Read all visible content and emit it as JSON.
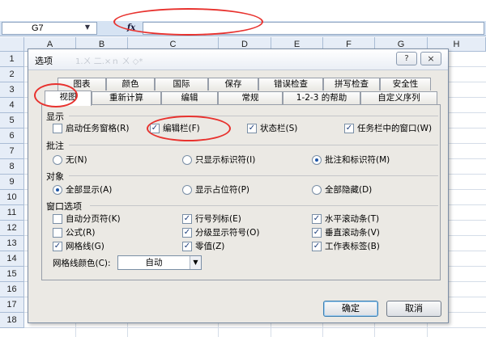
{
  "spreadsheet": {
    "name_box": "G7",
    "fx_symbol": "fx",
    "columns": [
      "A",
      "B",
      "C",
      "D",
      "E",
      "F",
      "G",
      "H"
    ],
    "rows": [
      "1",
      "2",
      "3",
      "4",
      "5",
      "6",
      "7",
      "8",
      "9",
      "10",
      "11",
      "12",
      "13",
      "14",
      "15",
      "16",
      "17",
      "18"
    ]
  },
  "dialog": {
    "title": "选项",
    "title_ghost": "1.ㄨ 二.×ｎ ㄨ ◇*",
    "help_icon": "?",
    "close_icon": "×",
    "tabs_back": [
      "图表",
      "颜色",
      "国际",
      "保存",
      "错误检查",
      "拼写检查",
      "安全性"
    ],
    "tabs_front": [
      "视图",
      "重新计算",
      "编辑",
      "常规",
      "1-2-3 的帮助",
      "自定义序列"
    ],
    "sections": {
      "show": {
        "label": "显示",
        "items": [
          {
            "label": "启动任务窗格(R)",
            "checked": false
          },
          {
            "label": "编辑栏(F)",
            "checked": true
          },
          {
            "label": "状态栏(S)",
            "checked": true
          },
          {
            "label": "任务栏中的窗口(W)",
            "checked": true
          }
        ]
      },
      "comments": {
        "label": "批注",
        "items": [
          {
            "label": "无(N)",
            "selected": false
          },
          {
            "label": "只显示标识符(I)",
            "selected": false
          },
          {
            "label": "批注和标识符(M)",
            "selected": true
          }
        ]
      },
      "objects": {
        "label": "对象",
        "items": [
          {
            "label": "全部显示(A)",
            "selected": true
          },
          {
            "label": "显示占位符(P)",
            "selected": false
          },
          {
            "label": "全部隐藏(D)",
            "selected": false
          }
        ]
      },
      "window": {
        "label": "窗口选项",
        "items": [
          {
            "label": "自动分页符(K)",
            "checked": false
          },
          {
            "label": "行号列标(E)",
            "checked": true
          },
          {
            "label": "水平滚动条(T)",
            "checked": true
          },
          {
            "label": "公式(R)",
            "checked": false
          },
          {
            "label": "分级显示符号(O)",
            "checked": true
          },
          {
            "label": "垂直滚动条(V)",
            "checked": true
          },
          {
            "label": "网格线(G)",
            "checked": true
          },
          {
            "label": "零值(Z)",
            "checked": true
          },
          {
            "label": "工作表标签(B)",
            "checked": true
          }
        ]
      }
    },
    "gridline_color": {
      "label": "网格线颜色(C):",
      "value": "自动"
    },
    "ok_label": "确定",
    "cancel_label": "取消"
  },
  "colors": {
    "annotation": "#e8322e",
    "accent": "#1f57a8"
  }
}
